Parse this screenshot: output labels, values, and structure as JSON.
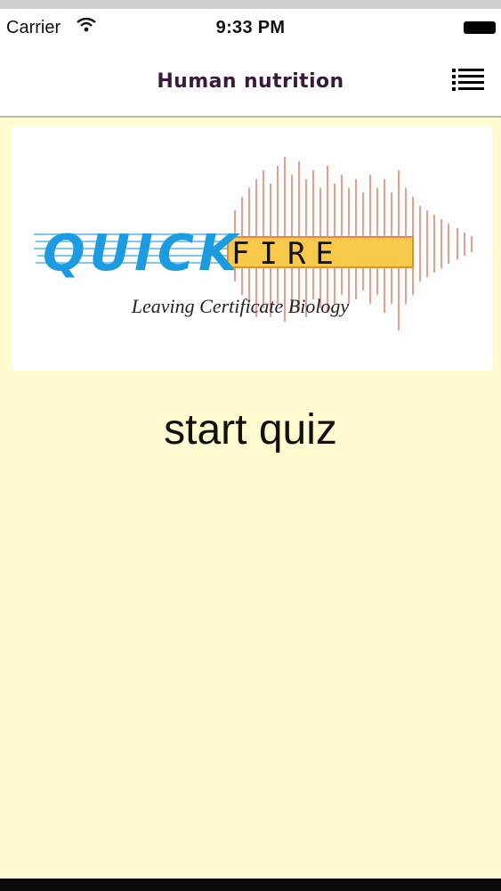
{
  "status": {
    "carrier": "Carrier",
    "time": "9:33 PM"
  },
  "nav": {
    "title": "Human nutrition",
    "menu_icon": "list-menu-icon"
  },
  "banner": {
    "word_left": "QUICK",
    "word_right": "FIRE",
    "tagline": "Leaving Certificate Biology"
  },
  "main": {
    "start_label": "start quiz"
  }
}
